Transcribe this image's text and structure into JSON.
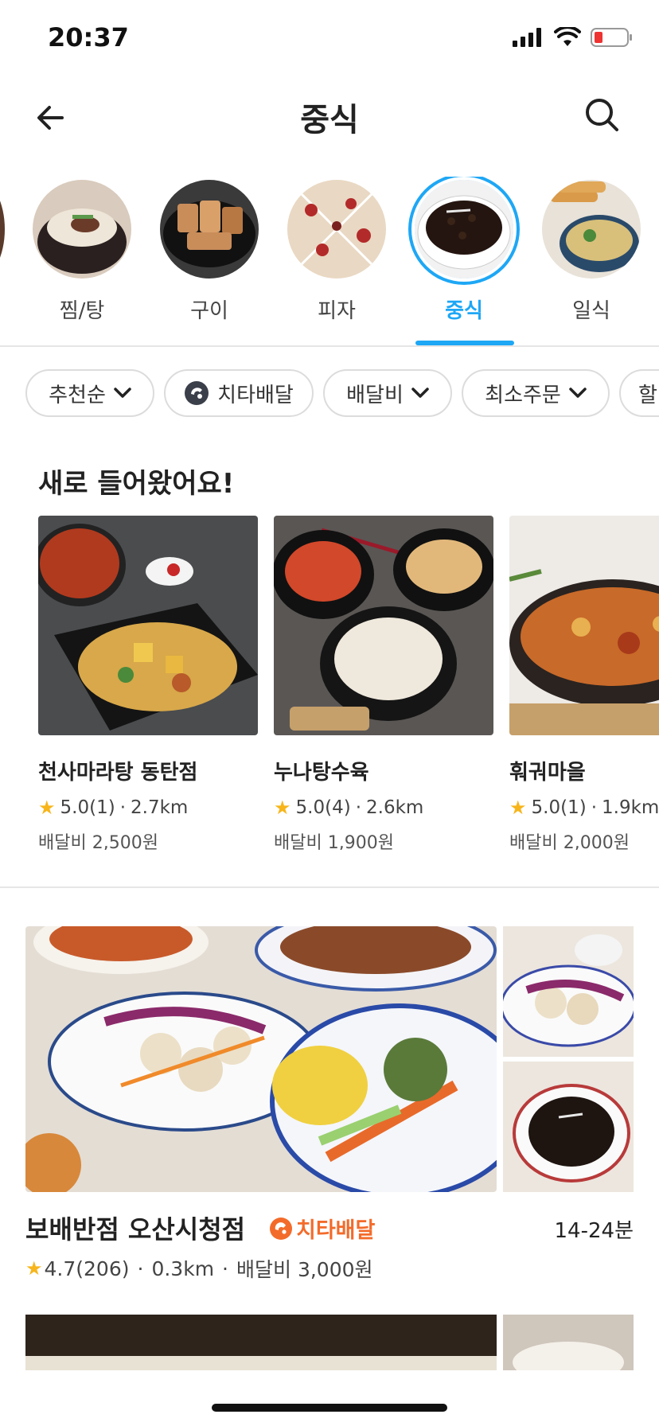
{
  "status_bar": {
    "time": "20:37"
  },
  "header": {
    "title": "중식",
    "back_icon": "arrow-left-icon",
    "search_icon": "search-icon"
  },
  "categories": [
    {
      "label": "찜/탕",
      "active": false
    },
    {
      "label": "구이",
      "active": false
    },
    {
      "label": "피자",
      "active": false
    },
    {
      "label": "중식",
      "active": true
    },
    {
      "label": "일식",
      "active": false
    }
  ],
  "filters": [
    {
      "label": "추천순",
      "icon": "chevron-down-icon"
    },
    {
      "label": "치타배달",
      "icon": "cheetah-icon"
    },
    {
      "label": "배달비",
      "icon": "chevron-down-icon"
    },
    {
      "label": "최소주문",
      "icon": "chevron-down-icon"
    },
    {
      "label": "할"
    }
  ],
  "new_section": {
    "title": "새로 들어왔어요!",
    "stores": [
      {
        "name": "천사마라탕 동탄점",
        "rating": "5.0(1)",
        "distance": "2.7km",
        "fee": "배달비 2,500원"
      },
      {
        "name": "누나탕수육",
        "rating": "5.0(4)",
        "distance": "2.6km",
        "fee": "배달비 1,900원"
      },
      {
        "name": "훠궈마을",
        "rating": "5.0(1)",
        "distance": "1.9km",
        "fee": "배달비 2,000원"
      }
    ]
  },
  "featured": {
    "name": "보배반점 오산시청점",
    "badge": "치타배달",
    "delivery_time": "14-24분",
    "rating": "4.7(206)",
    "distance": "0.3km",
    "fee": "배달비 3,000원"
  },
  "colors": {
    "accent": "#1ea7f5",
    "cheetah": "#f36b2a",
    "star": "#f7b51b"
  }
}
